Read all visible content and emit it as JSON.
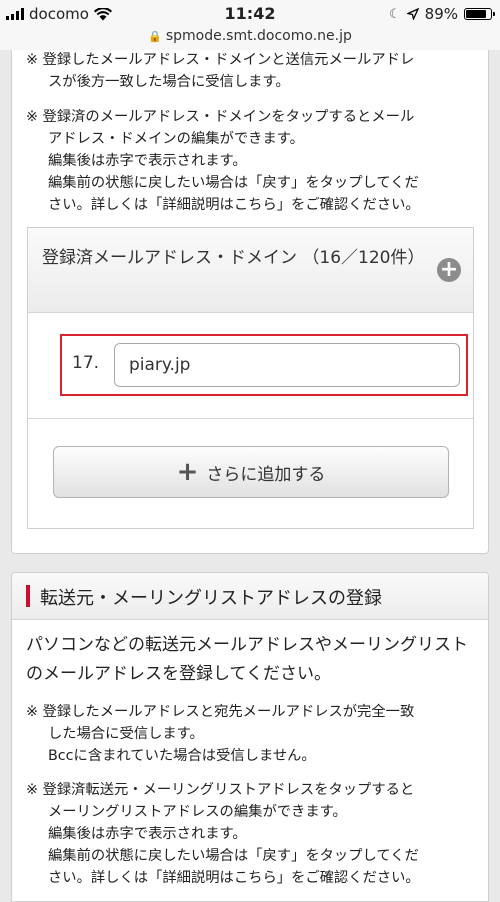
{
  "status": {
    "carrier": "docomo",
    "time": "11:42",
    "battery": "89%",
    "battery_level": 0.89,
    "icons": [
      "signal-icon",
      "wifi-icon",
      "moon-icon",
      "location-arrow-icon",
      "battery-icon"
    ]
  },
  "url": "spmode.smt.docomo.ne.jp",
  "card1": {
    "note1": [
      "※ 登録したメールアドレス・ドメインと送信元メールアドレ",
      "スが後方一致した場合に受信します。"
    ],
    "note2": [
      "※ 登録済のメールアドレス・ドメインをタップするとメール",
      "アドレス・ドメインの編集ができます。",
      "編集後は赤字で表示されます。",
      "編集前の状態に戻したい場合は「戻す」をタップしてくだ",
      "さい。詳しくは「詳細説明はこちら」をご確認ください。"
    ],
    "registered_title": "登録済メールアドレス・ドメイン （16／120件）",
    "entry": {
      "number": "17.",
      "value": "piary.jp"
    },
    "add_button": "さらに追加する"
  },
  "card2": {
    "title": "転送元・メーリングリストアドレスの登録",
    "intro": "パソコンなどの転送元メールアドレスやメーリングリストのメールアドレスを登録してください。",
    "note1": [
      "※ 登録したメールアドレスと宛先メールアドレスが完全一致",
      "した場合に受信します。",
      "Bccに含まれていた場合は受信しません。"
    ],
    "note2": [
      "※ 登録済転送元・メーリングリストアドレスをタップすると",
      "メーリングリストアドレスの編集ができます。",
      "編集後は赤字で表示されます。",
      "編集前の状態に戻したい場合は「戻す」をタップしてくだ",
      "さい。詳しくは「詳細説明はこちら」をご確認ください。"
    ]
  }
}
